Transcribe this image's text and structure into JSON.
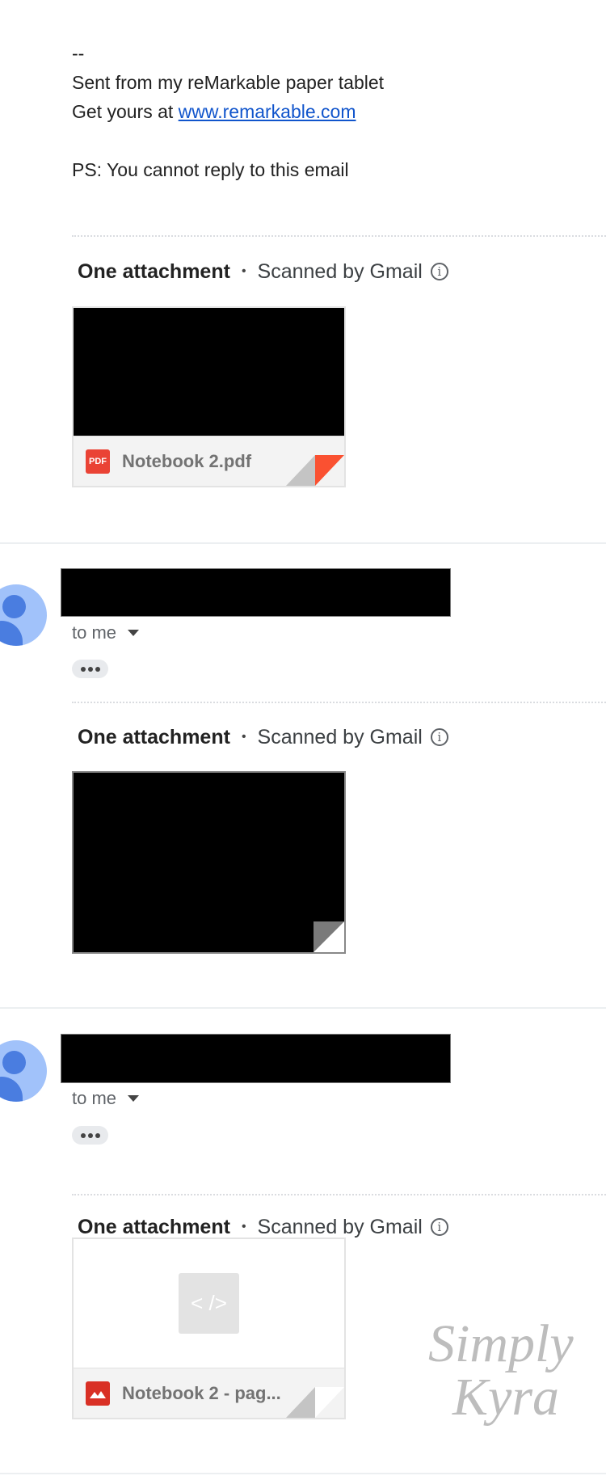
{
  "signature": {
    "separator": "--",
    "line1": "Sent from my reMarkable paper tablet",
    "line2_prefix": "Get yours at ",
    "link": "www.remarkable.com",
    "ps": "PS: You cannot reply to this email"
  },
  "messages": [
    {
      "attachment_header": {
        "count_label": "One attachment",
        "dot": "•",
        "scanned": "Scanned by Gmail",
        "info_icon": "i"
      },
      "attachment": {
        "name": "Notebook 2.pdf",
        "type_label": "PDF",
        "type_color": "#ea4335",
        "fold_color": "#fa5131"
      }
    },
    {
      "recipient": "to me",
      "attachment_header": {
        "count_label": "One attachment",
        "dot": "•",
        "scanned": "Scanned by Gmail",
        "info_icon": "i"
      },
      "attachment": {
        "name": "",
        "fold_color": "#7a7a7a"
      }
    },
    {
      "recipient": "to me",
      "attachment_header": {
        "count_label": "One attachment",
        "dot": "•",
        "scanned": "Scanned by Gmail",
        "info_icon": "i"
      },
      "attachment": {
        "name": "Notebook 2 - pag...",
        "type_color": "#d93025",
        "placeholder_glyph": "< />"
      }
    }
  ],
  "watermark": {
    "line1": "Simply",
    "line2": "Kyra"
  }
}
